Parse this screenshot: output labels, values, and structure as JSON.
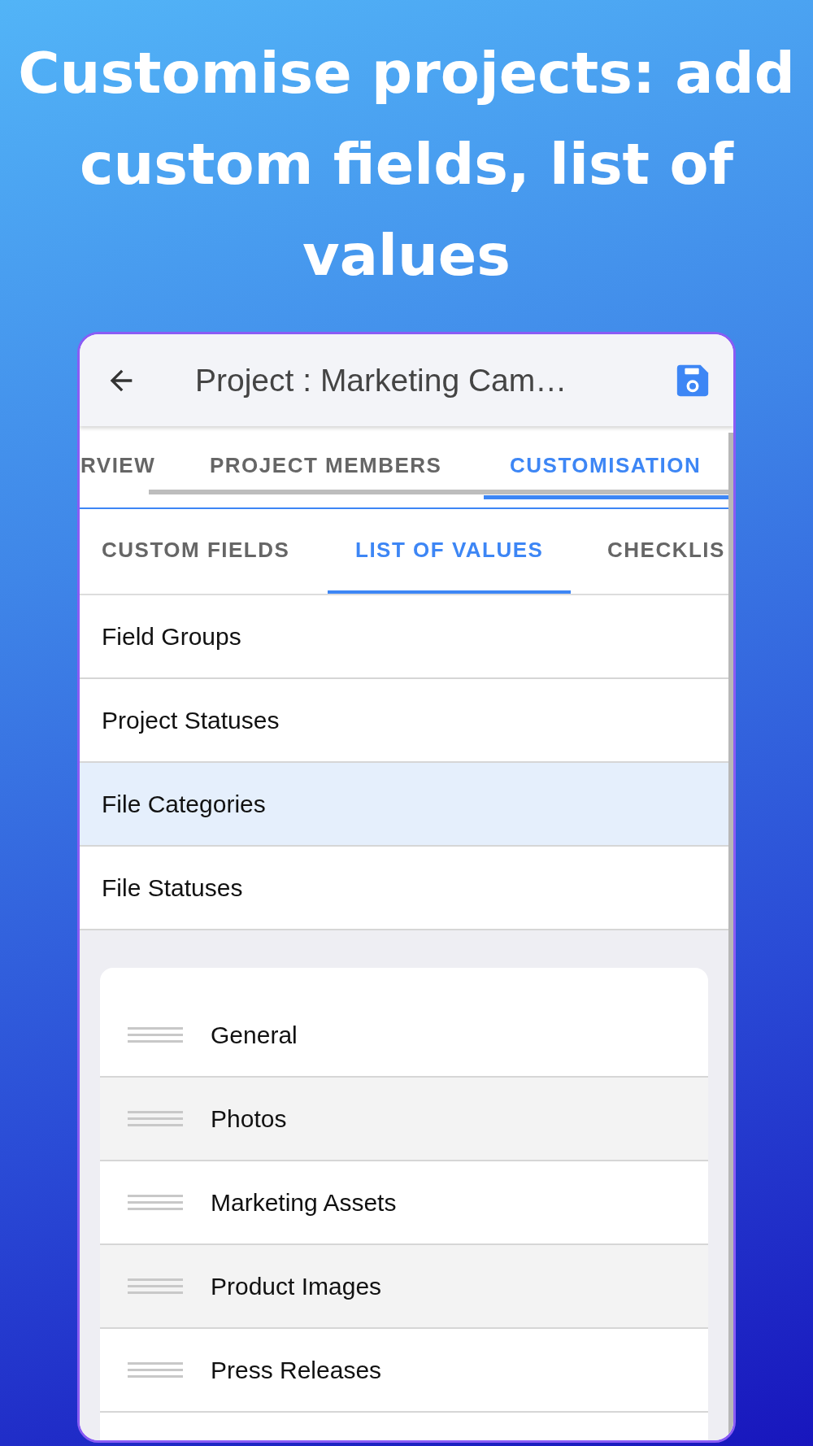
{
  "headline": "Customise projects: add custom fields, list of values",
  "app_bar": {
    "title": "Project : Marketing Cam…"
  },
  "tabs": [
    {
      "label": "RVIEW",
      "selected": false
    },
    {
      "label": "PROJECT MEMBERS",
      "selected": false
    },
    {
      "label": "CUSTOMISATION",
      "selected": true
    }
  ],
  "sub_tabs": [
    {
      "label": "CUSTOM FIELDS",
      "selected": false
    },
    {
      "label": "LIST OF VALUES",
      "selected": true
    },
    {
      "label": "CHECKLIS",
      "selected": false
    }
  ],
  "lists": [
    {
      "label": "Field Groups",
      "selected": false
    },
    {
      "label": "Project Statuses",
      "selected": false
    },
    {
      "label": "File Categories",
      "selected": true
    },
    {
      "label": "File Statuses",
      "selected": false
    }
  ],
  "values": [
    "General",
    "Photos",
    "Marketing Assets",
    "Product Images",
    "Press Releases"
  ]
}
